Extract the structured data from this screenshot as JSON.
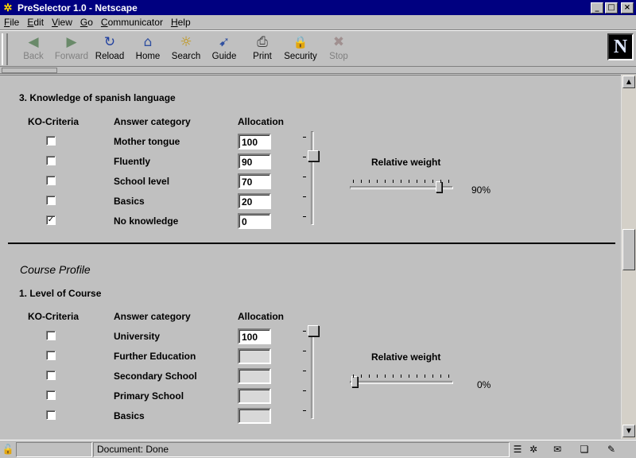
{
  "window": {
    "title": "PreSelector 1.0 - Netscape",
    "controls": {
      "minimize": "_",
      "maximize": "□",
      "close": "×"
    }
  },
  "menu": [
    "File",
    "Edit",
    "View",
    "Go",
    "Communicator",
    "Help"
  ],
  "toolbar": {
    "buttons": [
      {
        "label": "Back",
        "icon": "back-arrow-icon",
        "glyph": "◀",
        "enabled": false
      },
      {
        "label": "Forward",
        "icon": "forward-arrow-icon",
        "glyph": "▶",
        "enabled": false
      },
      {
        "label": "Reload",
        "icon": "reload-icon",
        "glyph": "↻",
        "enabled": true
      },
      {
        "label": "Home",
        "icon": "home-icon",
        "glyph": "⌂",
        "enabled": true
      },
      {
        "label": "Search",
        "icon": "search-icon",
        "glyph": "☼",
        "enabled": true
      },
      {
        "label": "Guide",
        "icon": "guide-icon",
        "glyph": "➹",
        "enabled": true
      },
      {
        "label": "Print",
        "icon": "print-icon",
        "glyph": "⎙",
        "enabled": true
      },
      {
        "label": "Security",
        "icon": "lock-icon",
        "glyph": "🔒",
        "enabled": true
      },
      {
        "label": "Stop",
        "icon": "stop-icon",
        "glyph": "✖",
        "enabled": false
      }
    ],
    "logo": "N"
  },
  "sections": {
    "language": {
      "heading": "3. Knowledge of spanish language",
      "col_ko": "KO-Criteria",
      "col_answer": "Answer category",
      "col_alloc": "Allocation",
      "rows": [
        {
          "label": "Mother tongue",
          "value": "100",
          "checked": false
        },
        {
          "label": "Fluently",
          "value": "90",
          "checked": false
        },
        {
          "label": "School level",
          "value": "70",
          "checked": false
        },
        {
          "label": "Basics",
          "value": "20",
          "checked": false
        },
        {
          "label": "No knowledge",
          "value": "0",
          "checked": true
        }
      ],
      "weight_label": "Relative weight",
      "weight_value": "90%",
      "weight_fraction": 0.9
    },
    "course_profile_title": "Course Profile",
    "course": {
      "heading": "1. Level of Course",
      "col_ko": "KO-Criteria",
      "col_answer": "Answer category",
      "col_alloc": "Allocation",
      "rows": [
        {
          "label": "University",
          "value": "100",
          "checked": false
        },
        {
          "label": "Further Education",
          "value": "",
          "checked": false
        },
        {
          "label": "Secondary School",
          "value": "",
          "checked": false
        },
        {
          "label": "Primary School",
          "value": "",
          "checked": false
        },
        {
          "label": "Basics",
          "value": "",
          "checked": false
        }
      ],
      "weight_label": "Relative weight",
      "weight_value": "0%",
      "weight_fraction": 0.0
    }
  },
  "status": {
    "text": "Document: Done"
  }
}
